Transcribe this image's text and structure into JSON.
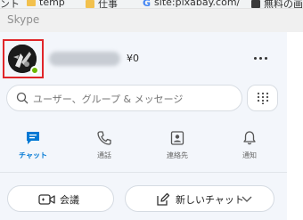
{
  "browser": {
    "bookmarks": [
      "ント",
      "temp",
      "仕事",
      "site:pixabay.com/",
      "無料の画"
    ]
  },
  "window": {
    "title": "Skype"
  },
  "profile": {
    "credit": "¥0"
  },
  "search": {
    "placeholder": "ユーザー、グループ & メッセージ"
  },
  "nav": [
    {
      "label": "チャット",
      "icon": "chat-icon",
      "active": true
    },
    {
      "label": "通話",
      "icon": "phone-icon",
      "active": false
    },
    {
      "label": "連絡先",
      "icon": "contacts-icon",
      "active": false
    },
    {
      "label": "通知",
      "icon": "bell-icon",
      "active": false
    }
  ],
  "actions": {
    "meet_label": "会議",
    "new_chat_label": "新しいチャット"
  },
  "colors": {
    "accent": "#0078d4",
    "presence": "#6bb700",
    "highlight": "#e0262a"
  }
}
